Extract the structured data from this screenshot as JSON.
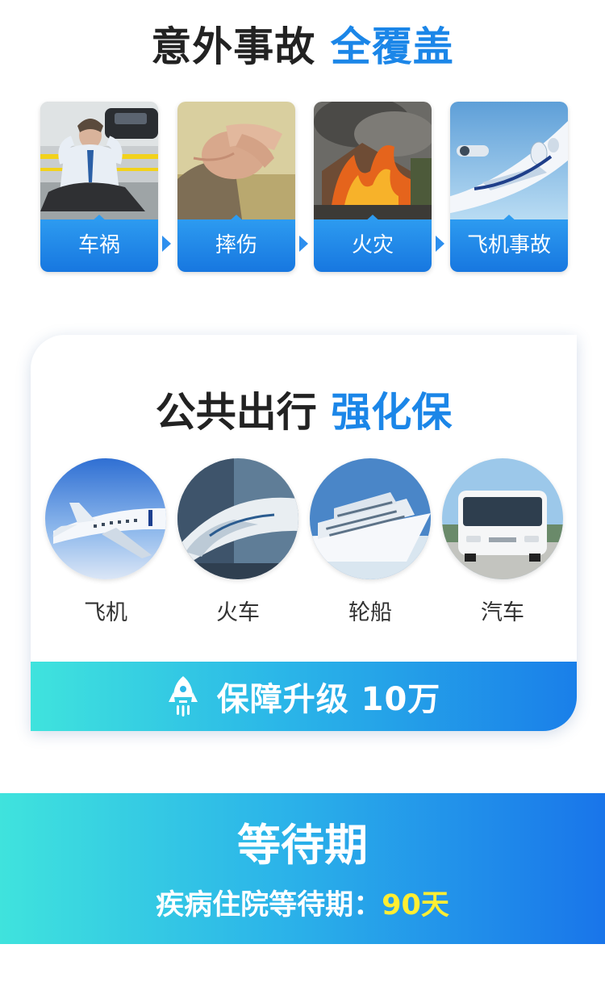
{
  "accident": {
    "title_main": "意外事故",
    "title_highlight": "全覆盖",
    "items": [
      {
        "label": "车祸",
        "icon": "car-accident-photo"
      },
      {
        "label": "摔伤",
        "icon": "knee-injury-photo"
      },
      {
        "label": "火灾",
        "icon": "house-fire-photo"
      },
      {
        "label": "飞机事故",
        "icon": "airplane-photo"
      }
    ]
  },
  "transport": {
    "title_main": "公共出行",
    "title_highlight": "强化保",
    "items": [
      {
        "label": "飞机",
        "icon": "airplane-photo"
      },
      {
        "label": "火车",
        "icon": "bullet-train-photo"
      },
      {
        "label": "轮船",
        "icon": "cruise-ship-photo"
      },
      {
        "label": "汽车",
        "icon": "bus-photo"
      }
    ],
    "banner_text": "保障升级 10万",
    "banner_icon": "rocket-icon"
  },
  "waiting": {
    "title": "等待期",
    "subtitle_label": "疾病住院等待期：",
    "subtitle_value": "90天"
  },
  "colors": {
    "accent_blue": "#1b86e8",
    "gradient_start": "#3fe3dd",
    "gradient_end": "#1975ea",
    "highlight_yellow": "#ffee33"
  }
}
